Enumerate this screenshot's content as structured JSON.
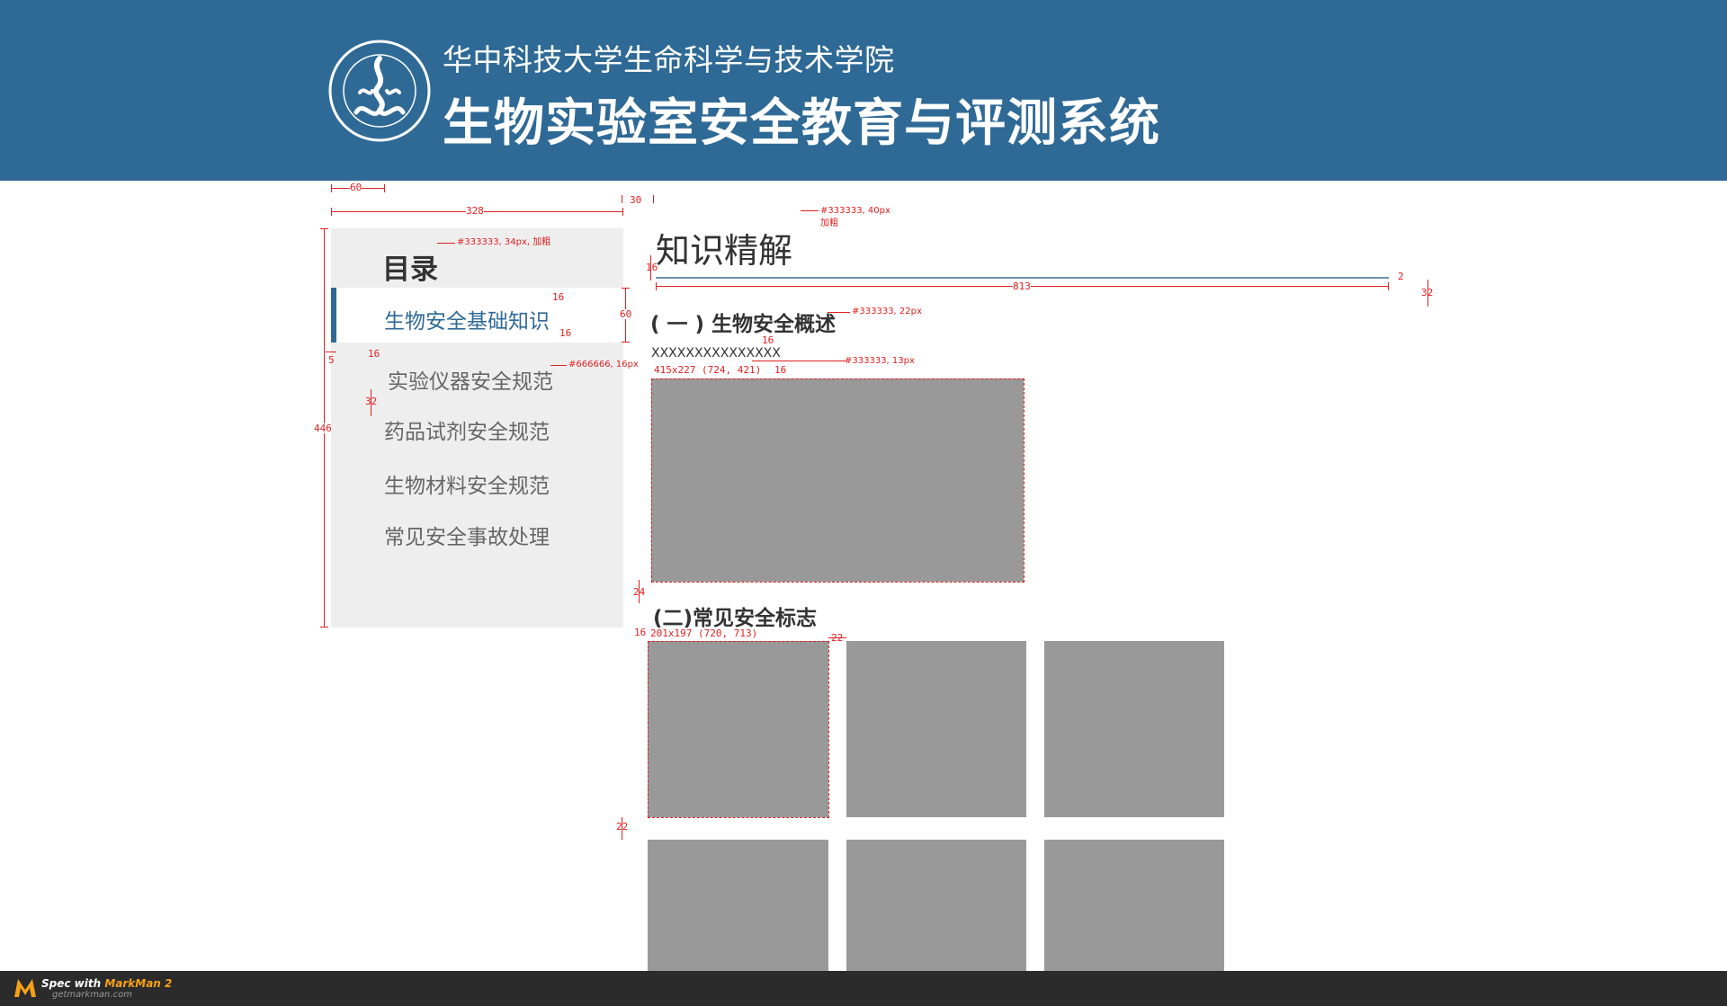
{
  "header": {
    "school_name": "华中科技大学生命科学与技术学院",
    "system_title": "生物实验室安全教育与评测系统",
    "brand_color": "#2f6a96",
    "logo_icon": "college-seal-icon"
  },
  "sidebar": {
    "title": "目录",
    "active_index": 0,
    "items": [
      {
        "label": "生物安全基础知识"
      },
      {
        "label": "实验仪器安全规范"
      },
      {
        "label": "药品试剂安全规范"
      },
      {
        "label": "生物材料安全规范"
      },
      {
        "label": "常见安全事故处理"
      }
    ]
  },
  "main": {
    "title": "知识精解",
    "sections": [
      {
        "heading": "( 一 ) 生物安全概述",
        "text": "XXXXXXXXXXXXXXX"
      },
      {
        "heading": "(二)常见安全标志"
      }
    ]
  },
  "annotations": {
    "dims": {
      "d60_top": "60",
      "d328": "328",
      "d30": "30",
      "d16_a": "16",
      "d16_b": "16",
      "d16_c": "16",
      "d16_d": "16",
      "d16_e": "16",
      "d16_f": "16",
      "d16_g": "16",
      "d60_side": "60",
      "d5": "5",
      "d32_a": "32",
      "d32_b": "32",
      "d446": "446",
      "d813": "813",
      "d2": "2",
      "d24": "24",
      "d22_a": "22",
      "d22_b": "22"
    },
    "notes": {
      "title_note_1": "#333333, 40px",
      "title_note_2": "加粗",
      "toc_title_note": "#333333, 34px, 加粗",
      "item_note": "#666666, 16px",
      "h1_note": "#333333, 22px",
      "text_note": "#333333, 13px",
      "image1_size": "415x227 (724, 421)",
      "image2_size": "201x197 (720, 713)"
    }
  },
  "footer": {
    "spec_with": "Spec with ",
    "app_name": "MarkMan 2",
    "url": "getmarkman.com"
  }
}
